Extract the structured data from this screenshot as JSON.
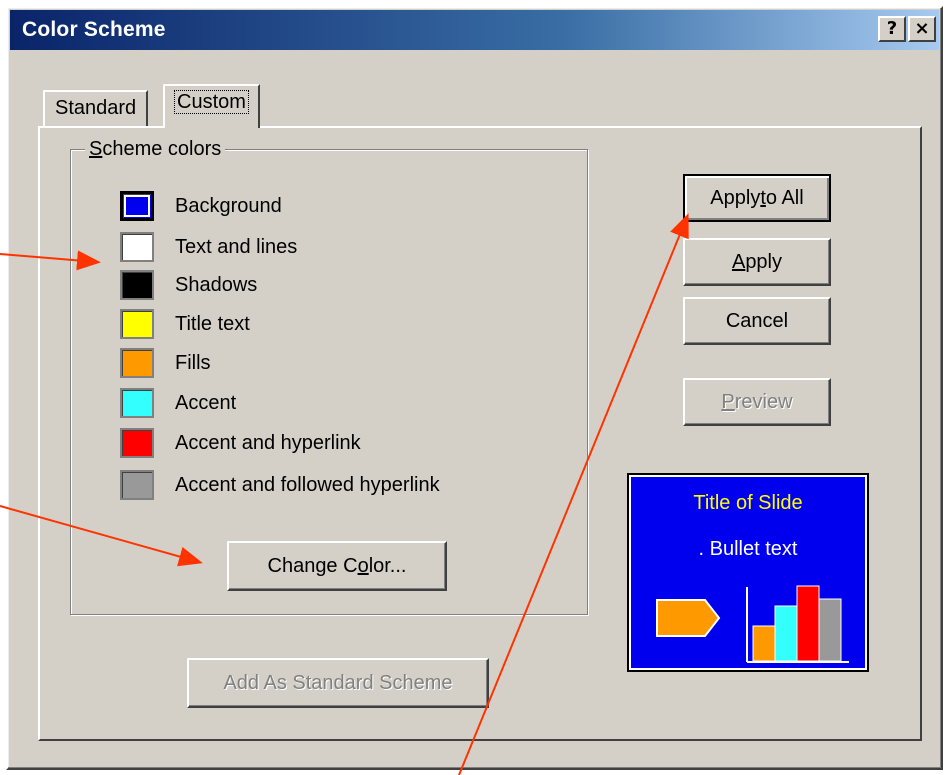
{
  "window": {
    "title": "Color Scheme",
    "help_button": "?",
    "close_button": "×"
  },
  "tabs": [
    {
      "label": "Standard",
      "active": false
    },
    {
      "label": "Custom",
      "active": true
    }
  ],
  "scheme_colors": {
    "legend_prefix": "S",
    "legend_rest": "cheme colors",
    "items": [
      {
        "label": "Background",
        "color": "#0000ee",
        "selected": true
      },
      {
        "label": "Text and lines",
        "color": "#ffffff"
      },
      {
        "label": "Shadows",
        "color": "#000000"
      },
      {
        "label": "Title text",
        "color": "#ffff00"
      },
      {
        "label": "Fills",
        "color": "#ff9900"
      },
      {
        "label": "Accent",
        "color": "#33ffff"
      },
      {
        "label": "Accent and hyperlink",
        "color": "#ff0000"
      },
      {
        "label": "Accent and followed hyperlink",
        "color": "#999999"
      }
    ]
  },
  "buttons": {
    "change_color": {
      "before": "Change C",
      "accel": "o",
      "after": "lor..."
    },
    "add_standard": {
      "label": "Add As Standard Scheme"
    },
    "apply_to_all": {
      "before": "Apply ",
      "accel": "t",
      "after": "o All"
    },
    "apply": {
      "before": "",
      "accel": "A",
      "after": "pply"
    },
    "cancel": {
      "label": "Cancel"
    },
    "preview": {
      "before": "",
      "accel": "P",
      "after": "review"
    }
  },
  "preview_slide": {
    "title": "Title of Slide",
    "bullet": ".   Bullet text",
    "background": "#0000ee",
    "title_color": "#ffff00",
    "bars": [
      {
        "color": "#ff9900",
        "value": 0.35
      },
      {
        "color": "#33ffff",
        "value": 0.55
      },
      {
        "color": "#ff0000",
        "value": 0.75
      },
      {
        "color": "#999999",
        "value": 0.62
      }
    ]
  },
  "annotation_color": "#ff3300"
}
